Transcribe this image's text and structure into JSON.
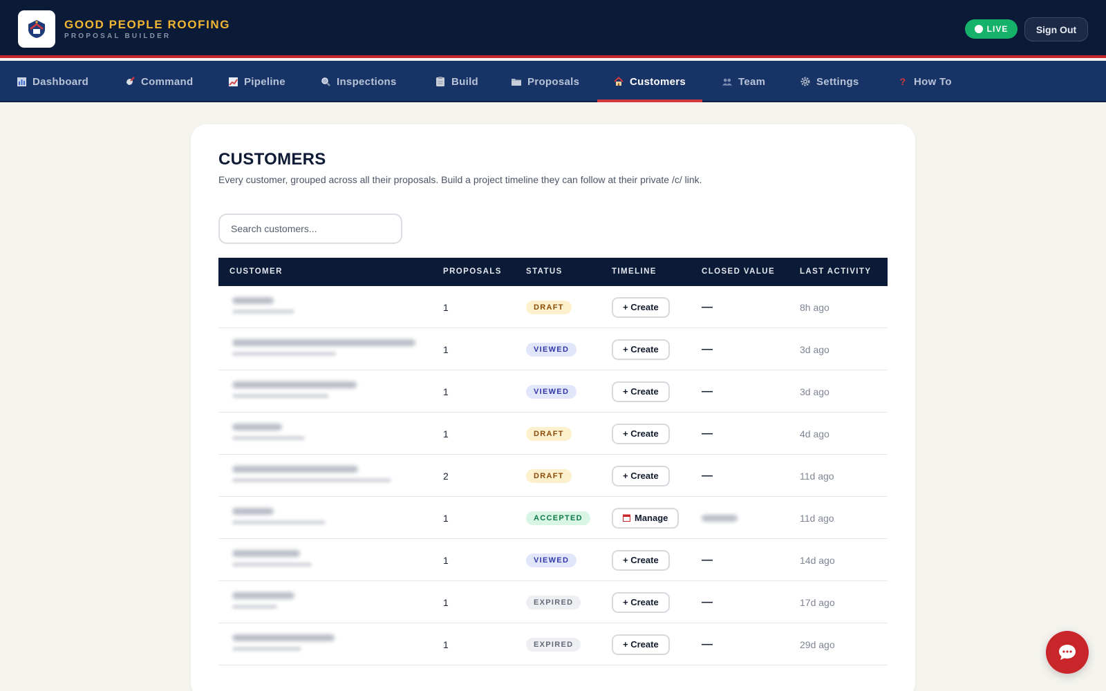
{
  "brand": {
    "title": "GOOD PEOPLE ROOFING",
    "subtitle": "PROPOSAL BUILDER"
  },
  "header": {
    "live_label": "LIVE",
    "signout_label": "Sign Out"
  },
  "nav": [
    {
      "label": "Dashboard",
      "icon": "bar-chart-icon",
      "active": false
    },
    {
      "label": "Command",
      "icon": "satellite-icon",
      "active": false
    },
    {
      "label": "Pipeline",
      "icon": "trend-chart-icon",
      "active": false
    },
    {
      "label": "Inspections",
      "icon": "magnifier-icon",
      "active": false
    },
    {
      "label": "Build",
      "icon": "clipboard-icon",
      "active": false
    },
    {
      "label": "Proposals",
      "icon": "folder-icon",
      "active": false
    },
    {
      "label": "Customers",
      "icon": "house-icon",
      "active": true
    },
    {
      "label": "Team",
      "icon": "people-icon",
      "active": false
    },
    {
      "label": "Settings",
      "icon": "gear-icon",
      "active": false
    },
    {
      "label": "How To",
      "icon": "question-icon",
      "active": false
    }
  ],
  "page": {
    "title": "CUSTOMERS",
    "description": "Every customer, grouped across all their proposals. Build a project timeline they can follow at their private /c/ link.",
    "search_placeholder": "Search customers..."
  },
  "table": {
    "columns": [
      "CUSTOMER",
      "PROPOSALS",
      "STATUS",
      "TIMELINE",
      "CLOSED VALUE",
      "LAST ACTIVITY"
    ],
    "rows": [
      {
        "proposals": "1",
        "status": "DRAFT",
        "status_type": "draft",
        "timeline": "+ Create",
        "closed_value": "—",
        "last_activity": "8h ago"
      },
      {
        "proposals": "1",
        "status": "VIEWED",
        "status_type": "viewed",
        "timeline": "+ Create",
        "closed_value": "—",
        "last_activity": "3d ago"
      },
      {
        "proposals": "1",
        "status": "VIEWED",
        "status_type": "viewed",
        "timeline": "+ Create",
        "closed_value": "—",
        "last_activity": "3d ago"
      },
      {
        "proposals": "1",
        "status": "DRAFT",
        "status_type": "draft",
        "timeline": "+ Create",
        "closed_value": "—",
        "last_activity": "4d ago"
      },
      {
        "proposals": "2",
        "status": "DRAFT",
        "status_type": "draft",
        "timeline": "+ Create",
        "closed_value": "—",
        "last_activity": "11d ago"
      },
      {
        "proposals": "1",
        "status": "ACCEPTED",
        "status_type": "accepted",
        "timeline": "Manage",
        "closed_value": "",
        "last_activity": "11d ago"
      },
      {
        "proposals": "1",
        "status": "VIEWED",
        "status_type": "viewed",
        "timeline": "+ Create",
        "closed_value": "—",
        "last_activity": "14d ago"
      },
      {
        "proposals": "1",
        "status": "EXPIRED",
        "status_type": "expired",
        "timeline": "+ Create",
        "closed_value": "—",
        "last_activity": "17d ago"
      },
      {
        "proposals": "1",
        "status": "EXPIRED",
        "status_type": "expired",
        "timeline": "+ Create",
        "closed_value": "—",
        "last_activity": "29d ago"
      }
    ]
  },
  "colors": {
    "header_bg": "#0b1a36",
    "nav_bg": "#183466",
    "accent_red": "#c8262b",
    "brand_gold": "#f2b632",
    "live_green": "#17b26a"
  }
}
